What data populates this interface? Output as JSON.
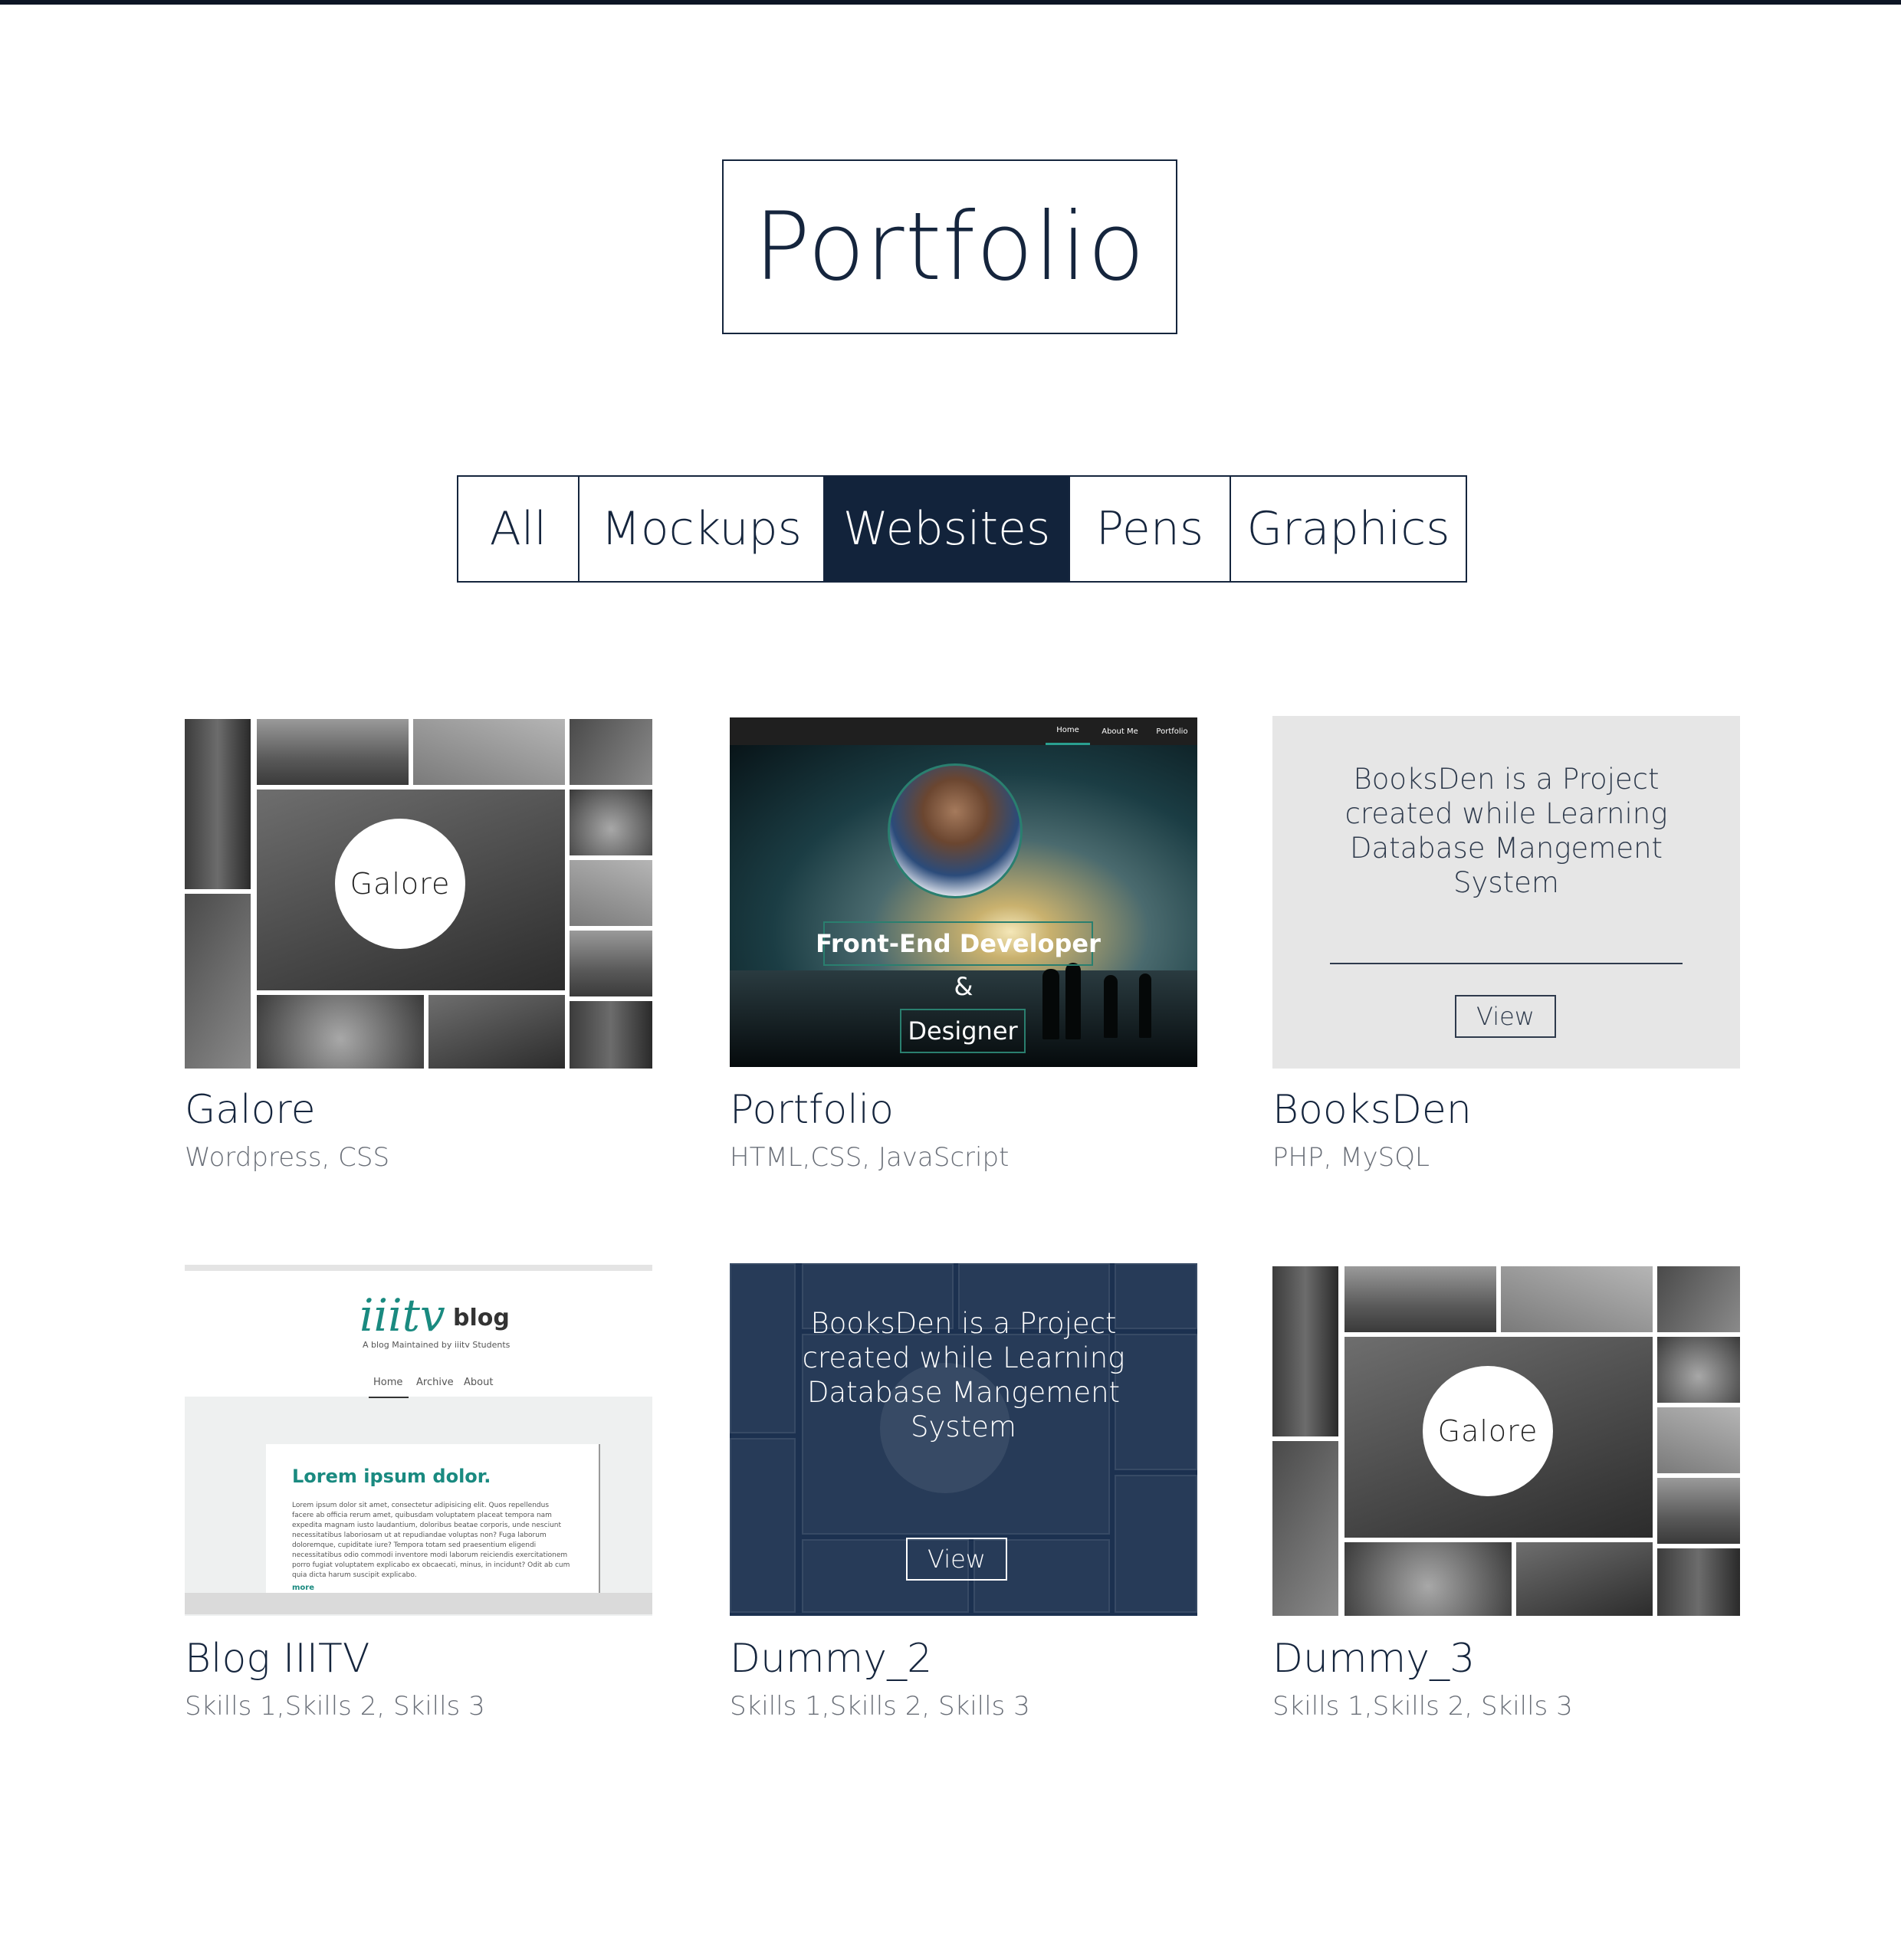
{
  "header": {
    "title": "Portfolio"
  },
  "filters": [
    {
      "label": "All",
      "active": false
    },
    {
      "label": "Mockups",
      "active": false
    },
    {
      "label": "Websites",
      "active": true
    },
    {
      "label": "Pens",
      "active": false
    },
    {
      "label": "Graphics",
      "active": false
    }
  ],
  "colors": {
    "accent": "#12233b",
    "text": "#15253d",
    "muted": "#6a6f78",
    "teal": "#1a8a80"
  },
  "projects": [
    {
      "title": "Galore",
      "skills": "Wordpress, CSS",
      "thumb_logo": "Galore"
    },
    {
      "title": "Portfolio",
      "skills": "HTML,CSS, JavaScript",
      "thumb_nav": [
        "Home",
        "About Me",
        "Portfolio"
      ],
      "thumb_role_1": "Front-End Developer",
      "thumb_amp": "&",
      "thumb_role_2": "Designer"
    },
    {
      "title": "BooksDen",
      "skills": "PHP, MySQL",
      "thumb_text": "BooksDen is a Project created while Learning Database Mangement System",
      "thumb_button": "View"
    },
    {
      "title": "Blog IIITV",
      "skills": "Skills 1,Skills 2, Skills 3",
      "thumb_logo": "iiitv",
      "thumb_logo_word": "blog",
      "thumb_tagline": "A blog Maintained by iiitv Students",
      "thumb_nav": [
        "Home",
        "Archive",
        "About"
      ],
      "thumb_heading": "Lorem ipsum dolor.",
      "thumb_body": "Lorem ipsum dolor sit amet, consectetur adipisicing elit. Quos repellendus facere ab officia rerum amet, quibusdam voluptatem placeat tempora nam expedita magnam iusto laudantium, doloribus beatae corporis, unde nesciunt necessitatibus laboriosam ut at repudiandae voluptas non? Fuga laborum doloremque, cupiditate iure? Tempora totam sed praesentium eligendi necessitatibus odio commodi inventore modi laborum reiciendis exercitationem porro fugiat voluptatem explicabo ex obcaecati, minus, in incidunt? Odit ab cum quia dicta harum suscipit explicabo.",
      "thumb_more": "more"
    },
    {
      "title": "Dummy_2",
      "skills": "Skills 1,Skills 2, Skills 3",
      "thumb_text": "BooksDen is a Project created while Learning Database Mangement System",
      "thumb_button": "View"
    },
    {
      "title": "Dummy_3",
      "skills": "Skills 1,Skills 2, Skills 3",
      "thumb_logo": "Galore"
    }
  ]
}
